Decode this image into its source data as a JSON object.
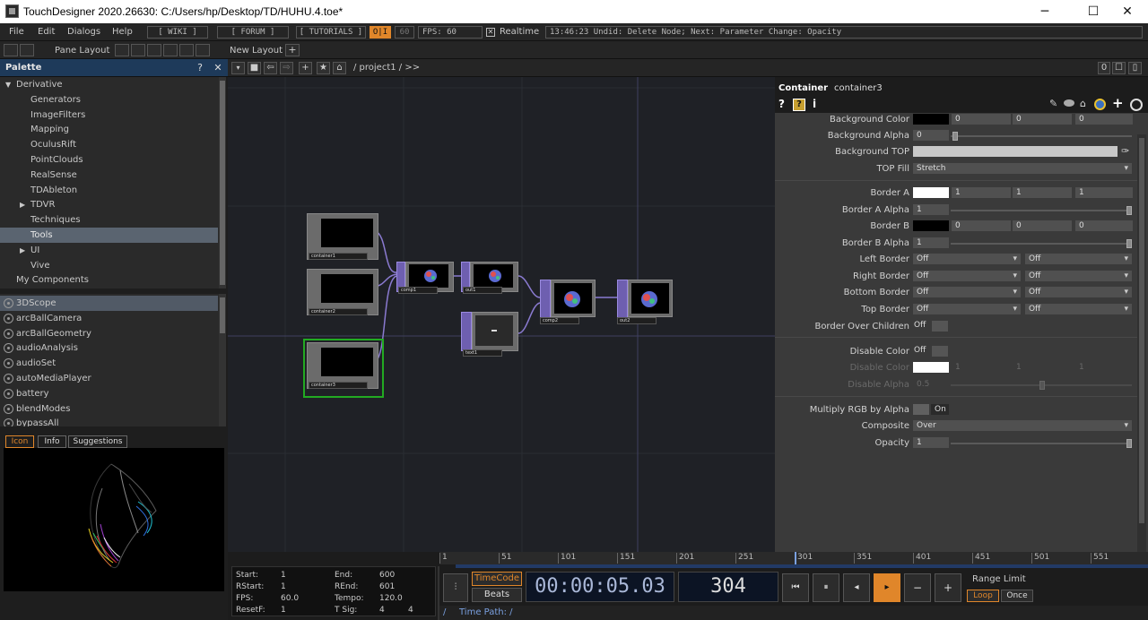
{
  "window": {
    "title": "TouchDesigner 2020.26630: C:/Users/hp/Desktop/TD/HUHU.4.toe*",
    "minimize": "─",
    "maximize": "☐",
    "close": "✕"
  },
  "menu": {
    "file": "File",
    "edit": "Edit",
    "dialogs": "Dialogs",
    "help": "Help",
    "wiki": "[ WIKI ]",
    "forum": "[ FORUM ]",
    "tutorials": "[ TUTORIALS ]",
    "oi": "O|I",
    "fps_target": "60",
    "fps": "FPS:  60",
    "realtime": "Realtime",
    "status": "13:46:23 Undid: Delete Node; Next: Parameter Change: Opacity"
  },
  "row2": {
    "pane_layout": "Pane Layout",
    "new_layout": "New Layout",
    "add": "+"
  },
  "palette": {
    "title": "Palette",
    "help": "?",
    "close": "✕",
    "tree": [
      {
        "label": "Derivative",
        "arrow": "▼",
        "indent": 0
      },
      {
        "label": "Generators",
        "arrow": "",
        "indent": 2
      },
      {
        "label": "ImageFilters",
        "arrow": "",
        "indent": 2
      },
      {
        "label": "Mapping",
        "arrow": "",
        "indent": 2
      },
      {
        "label": "OculusRift",
        "arrow": "",
        "indent": 2
      },
      {
        "label": "PointClouds",
        "arrow": "",
        "indent": 2
      },
      {
        "label": "RealSense",
        "arrow": "",
        "indent": 2
      },
      {
        "label": "TDAbleton",
        "arrow": "",
        "indent": 2
      },
      {
        "label": "TDVR",
        "arrow": "▶",
        "indent": 1
      },
      {
        "label": "Techniques",
        "arrow": "",
        "indent": 2
      },
      {
        "label": "Tools",
        "arrow": "",
        "indent": 2,
        "selected": true
      },
      {
        "label": "UI",
        "arrow": "▶",
        "indent": 1
      },
      {
        "label": "Vive",
        "arrow": "",
        "indent": 2
      },
      {
        "label": "My Components",
        "arrow": "",
        "indent": 0
      }
    ],
    "components": [
      "3DScope",
      "arcBallCamera",
      "arcBallGeometry",
      "audioAnalysis",
      "audioSet",
      "autoMediaPlayer",
      "battery",
      "blendModes",
      "bypassAll"
    ],
    "tabs": {
      "icon": "Icon",
      "info": "Info",
      "suggestions": "Suggestions"
    }
  },
  "network": {
    "path": "/ project1 / >>",
    "count": "0",
    "nodes": {
      "c1": "container1",
      "c2": "container2",
      "c3": "container3",
      "comp1": "comp1",
      "out1": "out1",
      "text1": "text1",
      "comp2": "comp2",
      "out2": "out2"
    }
  },
  "params": {
    "op_type": "Container",
    "op_name": "container3",
    "help": "?",
    "info": "i",
    "bg_color": {
      "label": "Background Color",
      "v": [
        "0",
        "0",
        "0"
      ],
      "swatch": "#000000"
    },
    "bg_alpha": {
      "label": "Background Alpha",
      "v": "0"
    },
    "bg_top": {
      "label": "Background TOP"
    },
    "top_fill": {
      "label": "TOP Fill",
      "v": "Stretch"
    },
    "border_a": {
      "label": "Border A",
      "v": [
        "1",
        "1",
        "1"
      ],
      "swatch": "#ffffff"
    },
    "border_a_alpha": {
      "label": "Border A Alpha",
      "v": "1"
    },
    "border_b": {
      "label": "Border B",
      "v": [
        "0",
        "0",
        "0"
      ],
      "swatch": "#000000"
    },
    "border_b_alpha": {
      "label": "Border B Alpha",
      "v": "1"
    },
    "left_border": {
      "label": "Left Border",
      "v": [
        "Off",
        "Off"
      ]
    },
    "right_border": {
      "label": "Right Border",
      "v": [
        "Off",
        "Off"
      ]
    },
    "bottom_border": {
      "label": "Bottom Border",
      "v": [
        "Off",
        "Off"
      ]
    },
    "top_border": {
      "label": "Top Border",
      "v": [
        "Off",
        "Off"
      ]
    },
    "border_over": {
      "label": "Border Over Children",
      "v": "Off"
    },
    "disable_color_tg": {
      "label": "Disable Color",
      "v": "Off"
    },
    "disable_color": {
      "label": "Disable Color",
      "v": [
        "1",
        "1",
        "1"
      ],
      "swatch": "#ffffff"
    },
    "disable_alpha": {
      "label": "Disable Alpha",
      "v": "0.5"
    },
    "multiply_rgb": {
      "label": "Multiply RGB by Alpha",
      "v": "On"
    },
    "composite": {
      "label": "Composite",
      "v": "Over"
    },
    "opacity": {
      "label": "Opacity",
      "v": "1"
    }
  },
  "timeline": {
    "ticks": [
      "1",
      "51",
      "101",
      "151",
      "201",
      "251",
      "301",
      "351",
      "401",
      "451",
      "501",
      "551"
    ],
    "start_l": "Start:",
    "start": "1",
    "rstart_l": "RStart:",
    "rstart": "1",
    "fps_l": "FPS:",
    "fps": "60.0",
    "resetf_l": "ResetF:",
    "resetf": "1",
    "end_l": "End:",
    "end": "600",
    "rend_l": "REnd:",
    "rend": "601",
    "tempo_l": "Tempo:",
    "tempo": "120.0",
    "tsig_l": "T Sig:",
    "tsig_a": "4",
    "tsig_b": "4",
    "timecode": "TimeCode",
    "beats": "Beats",
    "time": "00:00:05.03",
    "frame": "304",
    "range_limit": "Range Limit",
    "loop": "Loop",
    "once": "Once",
    "time_path": "Time Path: /",
    "slash": "/"
  }
}
